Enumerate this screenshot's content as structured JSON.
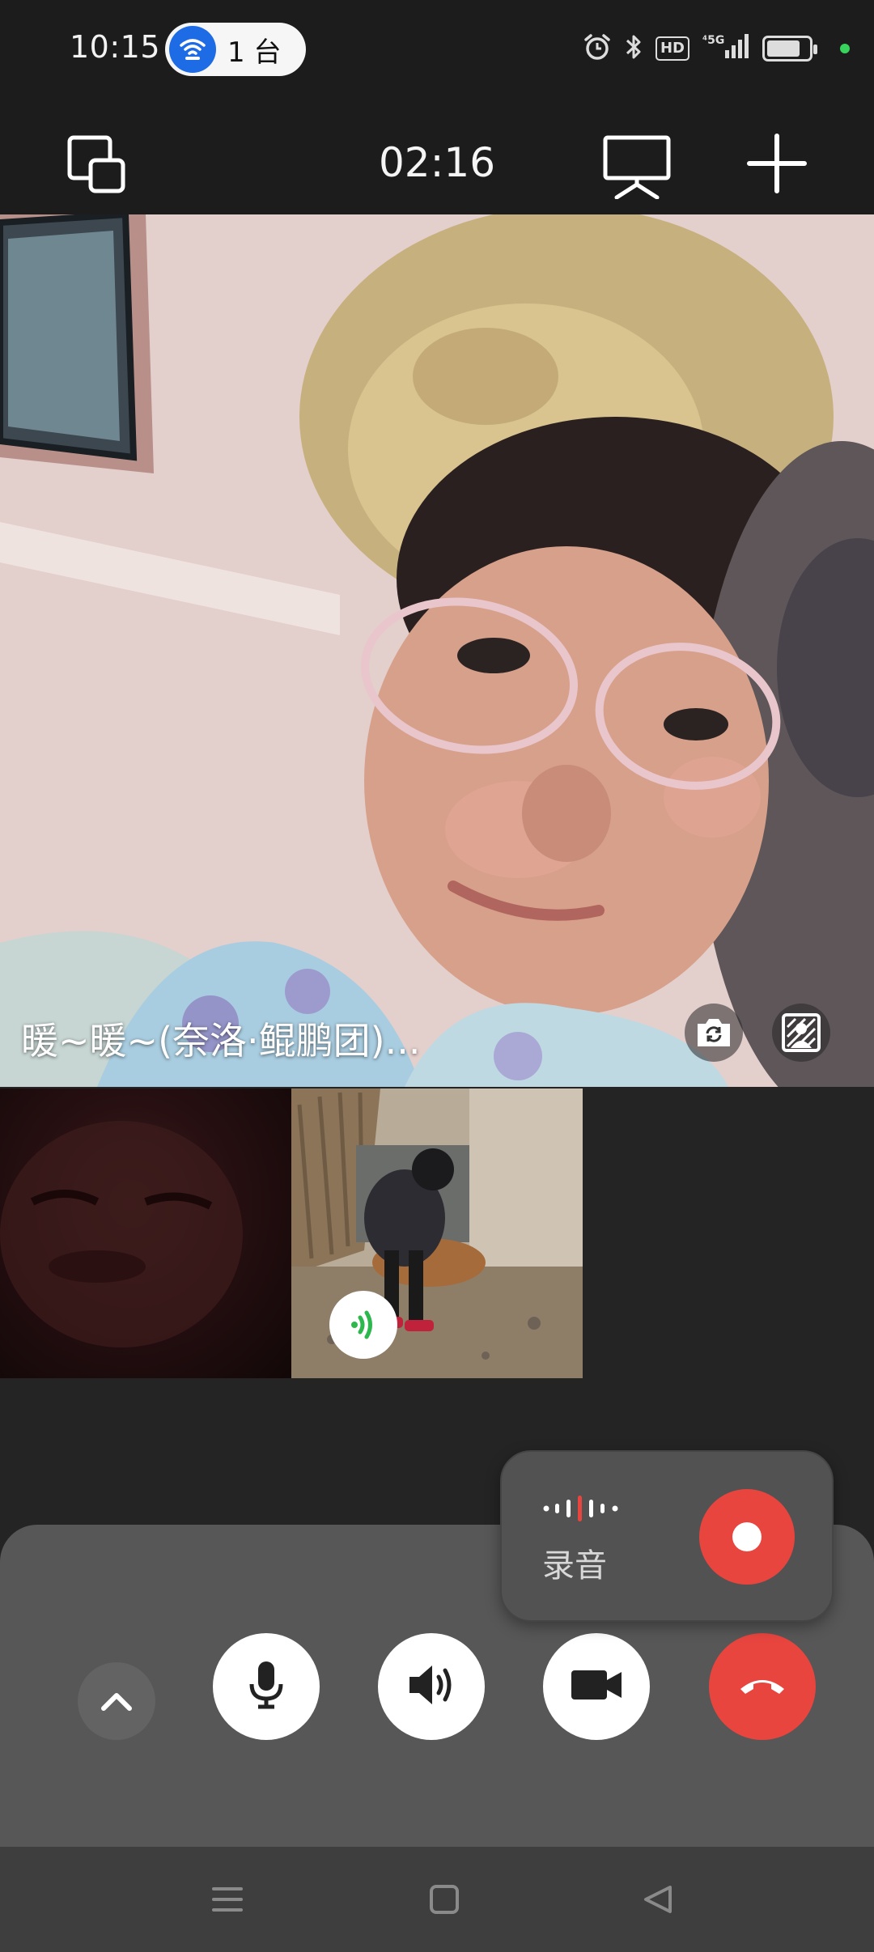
{
  "status_bar": {
    "time": "10:15",
    "hotspot_count": "1 台",
    "hd_badge": "HD",
    "network": "5G"
  },
  "toolbar": {
    "call_timer": "02:16"
  },
  "main_video": {
    "caller_name": "暖~暖~(奈洛·鲲鹏团)..."
  },
  "record_popup": {
    "label": "录音"
  },
  "colors": {
    "accent_blue": "#1e6be6",
    "hangup_red": "#e8453f",
    "speaking_green": "#2db84d",
    "panel_gray": "#575757"
  },
  "icons": {
    "toolbar": [
      "switch-window-icon",
      "screen-share-icon",
      "add-icon"
    ],
    "controls": [
      "chevron-up-icon",
      "microphone-icon",
      "speaker-icon",
      "video-camera-icon",
      "hang-up-icon"
    ],
    "video": [
      "flip-camera-icon",
      "background-icon"
    ],
    "nav": [
      "menu-icon",
      "home-icon",
      "back-icon"
    ]
  }
}
